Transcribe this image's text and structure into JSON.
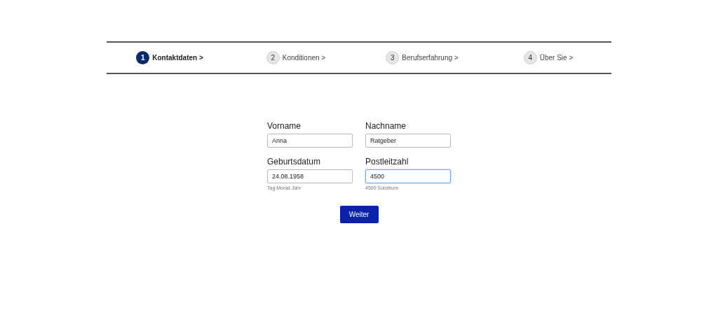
{
  "steps": [
    {
      "number": "1",
      "label": "Kontaktdaten >",
      "selected": true
    },
    {
      "number": "2",
      "label": "Konditionen >",
      "selected": false
    },
    {
      "number": "3",
      "label": "Berufserfahrung >",
      "selected": false
    },
    {
      "number": "4",
      "label": "Über Sie >",
      "selected": false
    }
  ],
  "fields": [
    {
      "label": "Vorname",
      "value": "Anna",
      "focused": false
    },
    {
      "label": "Nachname",
      "value": "Ratgeber",
      "focused": false
    },
    {
      "label": "Geburtsdatum",
      "value": "24.08.1958",
      "hint": "Tag.Monat.Jahr",
      "focused": false
    },
    {
      "label": "Postleitzahl",
      "value": "4500",
      "hint": "4500 Solothurn",
      "focused": true
    }
  ],
  "submit": {
    "label": "Weiter"
  }
}
